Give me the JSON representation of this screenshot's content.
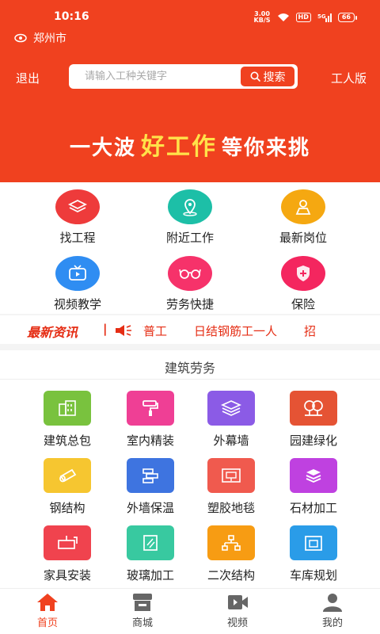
{
  "status_bar": {
    "time": "10:16",
    "speed_value": "3.00",
    "speed_unit": "KB/S",
    "hd": "HD",
    "signal": "5G",
    "battery": "66"
  },
  "location": {
    "city": "郑州市"
  },
  "header": {
    "exit_label": "退出",
    "search_placeholder": "请输入工种关键字",
    "search_button": "搜索",
    "worker_label": "工人版"
  },
  "banner": {
    "part1": "一大波",
    "highlight": "好工作",
    "part2": "等你来挑",
    "highlight_color": "#ffe24a"
  },
  "quick_menu": [
    {
      "label": "找工程",
      "icon": "layers-icon",
      "color": "#ee3b3b"
    },
    {
      "label": "附近工作",
      "icon": "location-pin-icon",
      "color": "#1dbfa7"
    },
    {
      "label": "最新岗位",
      "icon": "worker-icon",
      "color": "#f5a811"
    },
    {
      "label": "视频教学",
      "icon": "tv-icon",
      "color": "#2f8df2"
    },
    {
      "label": "劳务快捷",
      "icon": "glasses-icon",
      "color": "#f6326a"
    },
    {
      "label": "保险",
      "icon": "shield-icon",
      "color": "#f4265f"
    }
  ],
  "news": {
    "title": "最新资讯",
    "items": [
      "璃普工",
      "日结钢筋工一人",
      "招"
    ]
  },
  "category_section": {
    "title": "建筑劳务",
    "items": [
      {
        "label": "建筑总包",
        "icon": "building-icon",
        "color": "#79c23e"
      },
      {
        "label": "室内精装",
        "icon": "paint-roller-icon",
        "color": "#ef3f95"
      },
      {
        "label": "外幕墙",
        "icon": "layers-icon",
        "color": "#8b5be6"
      },
      {
        "label": "园建绿化",
        "icon": "trees-icon",
        "color": "#e55334"
      },
      {
        "label": "钢结构",
        "icon": "steel-tube-icon",
        "color": "#f6c630"
      },
      {
        "label": "外墙保温",
        "icon": "wall-brick-icon",
        "color": "#3e74e0"
      },
      {
        "label": "塑胶地毯",
        "icon": "carpet-icon",
        "color": "#f05a4e"
      },
      {
        "label": "石材加工",
        "icon": "stone-stack-icon",
        "color": "#bf41e0"
      },
      {
        "label": "家具安装",
        "icon": "furniture-icon",
        "color": "#f0434e"
      },
      {
        "label": "玻璃加工",
        "icon": "glass-pane-icon",
        "color": "#38c9a0"
      },
      {
        "label": "二次结构",
        "icon": "structure-icon",
        "color": "#f79c13"
      },
      {
        "label": "车库规划",
        "icon": "garage-icon",
        "color": "#2a9ce8"
      }
    ]
  },
  "bottom_nav": [
    {
      "label": "首页",
      "icon": "home-icon",
      "active": true
    },
    {
      "label": "商城",
      "icon": "store-icon",
      "active": false
    },
    {
      "label": "视频",
      "icon": "video-camera-icon",
      "active": false
    },
    {
      "label": "我的",
      "icon": "profile-icon",
      "active": false
    }
  ],
  "colors": {
    "brand": "#f0411f",
    "news_text": "#e52d14"
  }
}
